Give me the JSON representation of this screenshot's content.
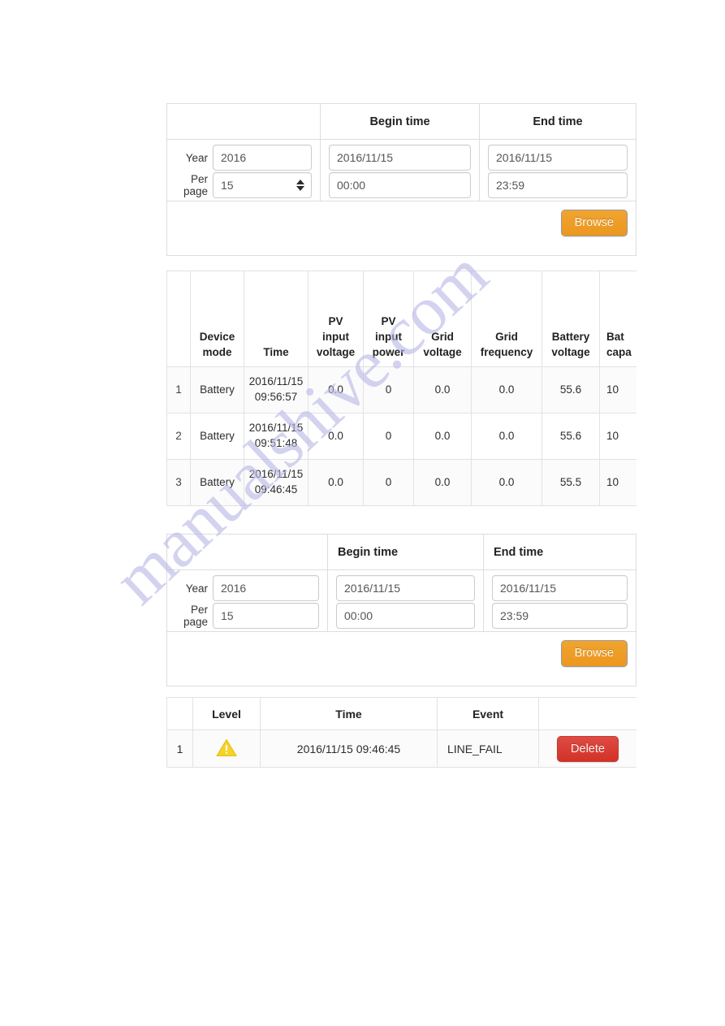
{
  "watermark": {
    "text": "manualshive.com",
    "color": "#b9b9e8"
  },
  "theme": {
    "browse_button_color": "#ec971f",
    "delete_button_color": "#d23228",
    "warning_icon_color": "#f2d024",
    "border_color": "#dddddd",
    "row_alt_color": "#fbfbfb"
  },
  "search_form_top": {
    "headers": {
      "blank": "",
      "begin_time": "Begin time",
      "end_time": "End time"
    },
    "fields": {
      "year_label": "Year",
      "year_value": "2016",
      "per_page_label_line1": "Per",
      "per_page_label_line2": "page",
      "per_page_value": "15",
      "begin_date": "2016/11/15",
      "begin_time": "00:00",
      "end_date": "2016/11/15",
      "end_time": "23:59"
    },
    "browse_button": "Browse"
  },
  "log_table": {
    "columns": [
      "",
      "Device mode",
      "Time",
      "PV input voltage",
      "PV input power",
      "Grid voltage",
      "Grid frequency",
      "Battery voltage",
      "Battery capacity"
    ],
    "columns_wrapped": [
      [
        "",
        ""
      ],
      [
        "Device",
        "mode"
      ],
      [
        "",
        "Time"
      ],
      [
        "PV",
        "input",
        "voltage"
      ],
      [
        "PV",
        "input",
        "power"
      ],
      [
        "Grid",
        "voltage"
      ],
      [
        "Grid",
        "frequency"
      ],
      [
        "Battery",
        "voltage"
      ],
      [
        "Bat",
        "capa"
      ]
    ],
    "rows": [
      {
        "index": "1",
        "device_mode": "Battery",
        "time_date": "2016/11/15",
        "time_clock": "09:56:57",
        "pv_input_voltage": "0.0",
        "pv_input_power": "0",
        "grid_voltage": "0.0",
        "grid_frequency": "0.0",
        "battery_voltage": "55.6",
        "battery_capacity": "10"
      },
      {
        "index": "2",
        "device_mode": "Battery",
        "time_date": "2016/11/15",
        "time_clock": "09:51:48",
        "pv_input_voltage": "0.0",
        "pv_input_power": "0",
        "grid_voltage": "0.0",
        "grid_frequency": "0.0",
        "battery_voltage": "55.6",
        "battery_capacity": "10"
      },
      {
        "index": "3",
        "device_mode": "Battery",
        "time_date": "2016/11/15",
        "time_clock": "09:46:45",
        "pv_input_voltage": "0.0",
        "pv_input_power": "0",
        "grid_voltage": "0.0",
        "grid_frequency": "0.0",
        "battery_voltage": "55.5",
        "battery_capacity": "10"
      }
    ]
  },
  "search_form_bottom": {
    "headers": {
      "blank": "",
      "begin_time": "Begin time",
      "end_time": "End time"
    },
    "fields": {
      "year_label": "Year",
      "year_value": "2016",
      "per_page_label_line1": "Per",
      "per_page_label_line2": "page",
      "per_page_value": "15",
      "begin_date": "2016/11/15",
      "begin_time": "00:00",
      "end_date": "2016/11/15",
      "end_time": "23:59"
    },
    "browse_button": "Browse"
  },
  "event_table": {
    "columns": [
      "",
      "Level",
      "Time",
      "Event",
      ""
    ],
    "rows": [
      {
        "index": "1",
        "level_icon": "warning-triangle-icon",
        "time": "2016/11/15 09:46:45",
        "event": "LINE_FAIL",
        "delete_button": "Delete"
      }
    ]
  }
}
